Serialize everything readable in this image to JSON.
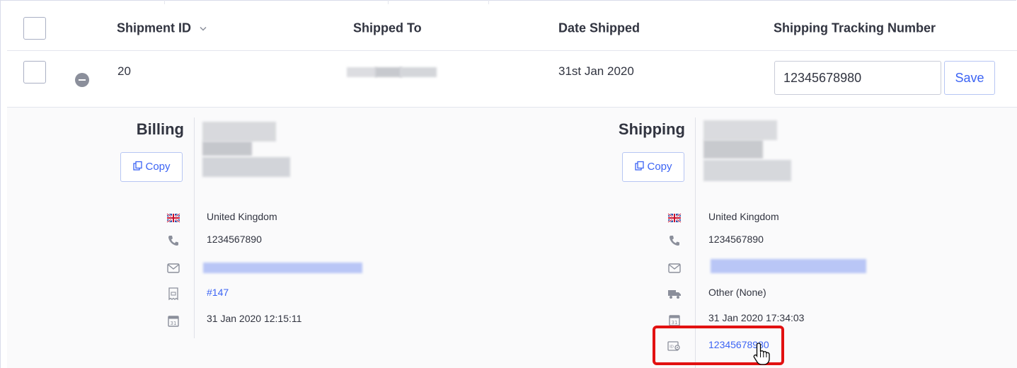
{
  "header": {
    "shipment_id": "Shipment ID",
    "shipped_to": "Shipped To",
    "date_shipped": "Date Shipped",
    "tracking_number": "Shipping Tracking Number"
  },
  "row": {
    "shipment_id": "20",
    "date_shipped": "31st Jan 2020",
    "tracking_value": "12345678980",
    "save_label": "Save"
  },
  "billing": {
    "title": "Billing",
    "copy_label": "Copy",
    "country": "United Kingdom",
    "phone": "1234567890",
    "order_link": "#147",
    "datetime": "31 Jan 2020 12:15:11"
  },
  "shipping": {
    "title": "Shipping",
    "copy_label": "Copy",
    "country": "United Kingdom",
    "phone": "1234567890",
    "method": "Other (None)",
    "datetime": "31 Jan 2020 17:34:03",
    "tracking_link": "12345678980"
  },
  "colors": {
    "accent": "#3c64f4",
    "highlight": "#e21111",
    "text": "#313440"
  },
  "icons": [
    "chevron-down-icon",
    "collapse-minus-icon",
    "uk-flag-icon",
    "phone-icon",
    "email-icon",
    "receipt-icon",
    "truck-icon",
    "calendar-icon",
    "tracking-id-icon",
    "copy-icon",
    "hand-pointer-cursor"
  ]
}
